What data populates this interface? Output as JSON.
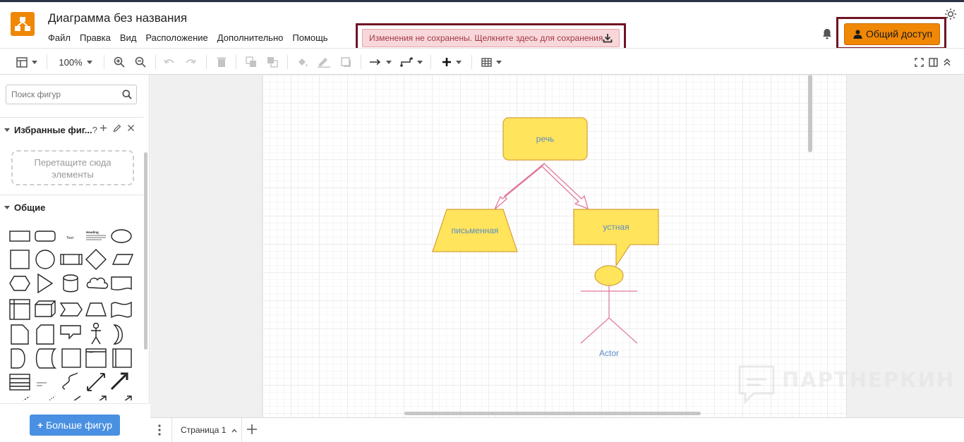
{
  "app": {
    "title": "Диаграмма без названия",
    "menu": [
      "Файл",
      "Правка",
      "Вид",
      "Расположение",
      "Дополнительно",
      "Помощь"
    ],
    "unsaved_notice": "Изменения не сохранены. Щелкните здесь для сохранения.",
    "share_label": "Общий доступ",
    "accent_color": "#f08705"
  },
  "toolbar": {
    "zoom": "100%"
  },
  "sidebar": {
    "search_placeholder": "Поиск фигур",
    "favorites_title": "Избранные фиг...",
    "favorites_help": "?",
    "dropzone_text": "Перетащите сюда элементы",
    "general_title": "Общие",
    "shape_text_label": "Text",
    "shape_heading_label": "Heading",
    "more_shapes_label": "Больше фигур"
  },
  "diagram": {
    "nodes": [
      {
        "id": "speech",
        "label": "речь",
        "fill": "#ffe45c",
        "stroke": "#d6a23a"
      },
      {
        "id": "written",
        "label": "письменная",
        "fill": "#ffe45c",
        "stroke": "#d6a23a"
      },
      {
        "id": "oral",
        "label": "устная",
        "fill": "#ffe45c",
        "stroke": "#d6a23a"
      },
      {
        "id": "actor",
        "label": "Actor",
        "fill": "#ffe45c",
        "stroke": "#e0789a"
      }
    ],
    "label_color": "#5b8cc7",
    "arrow_stroke": "#e0789a"
  },
  "pages": {
    "current_tab": "Страница 1"
  },
  "watermark": {
    "text": "ПАРТНЕРКИН"
  }
}
